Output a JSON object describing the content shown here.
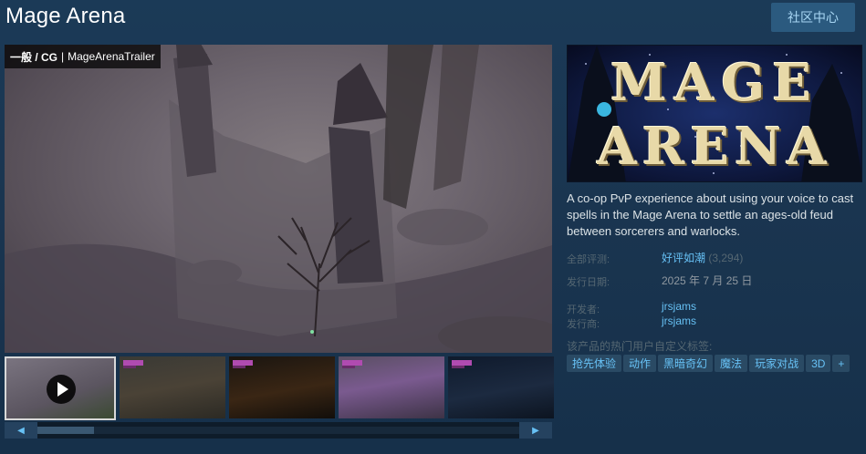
{
  "header": {
    "title": "Mage Arena",
    "community_button": "社区中心"
  },
  "media": {
    "caption_category": "一般 / CG",
    "caption_separator": "|",
    "caption_name": "MageArenaTrailer"
  },
  "thumbnails": [
    {
      "label": "video-trailer",
      "selected": true
    },
    {
      "label": "screenshot-1"
    },
    {
      "label": "screenshot-2"
    },
    {
      "label": "screenshot-3"
    },
    {
      "label": "screenshot-4"
    }
  ],
  "scrollbar": {
    "left_arrow": "◀",
    "right_arrow": "▶"
  },
  "capsule": {
    "line1": "MAGE",
    "line2": "ARENA"
  },
  "description": "A co-op PvP experience about using your voice to cast spells in the Mage Arena to settle an ages-old feud between sorcerers and warlocks.",
  "info": {
    "reviews_label": "全部评测:",
    "reviews_value": "好评如潮",
    "reviews_count": "(3,294)",
    "release_label": "发行日期:",
    "release_value": "2025 年 7 月 25 日",
    "developer_label": "开发者:",
    "developer_value": "jrsjams",
    "publisher_label": "发行商:",
    "publisher_value": "jrsjams"
  },
  "tags_label": "该产品的热门用户自定义标签:",
  "tags": [
    "抢先体验",
    "动作",
    "黑暗奇幻",
    "魔法",
    "玩家对战",
    "3D",
    "+"
  ],
  "colors": {
    "link": "#66c0f4",
    "tag_bg": "#2a4a64",
    "button_bg": "#2b5a7f",
    "page_bg": "#1b3a57"
  }
}
